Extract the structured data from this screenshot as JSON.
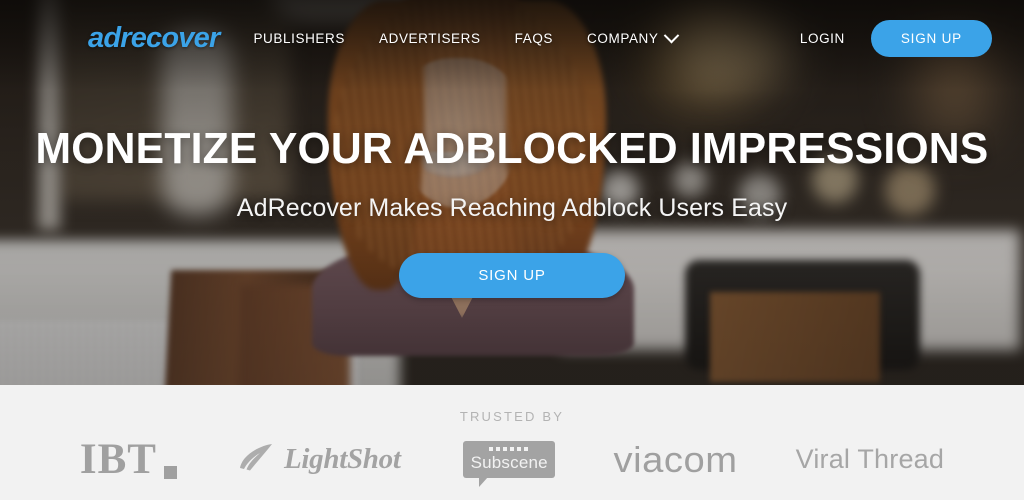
{
  "brand": {
    "logo_text": "adrecover",
    "accent_color": "#3ba3e8"
  },
  "nav": {
    "links": [
      {
        "label": "PUBLISHERS",
        "has_caret": false
      },
      {
        "label": "ADVERTISERS",
        "has_caret": false
      },
      {
        "label": "FAQS",
        "has_caret": false
      },
      {
        "label": "COMPANY",
        "has_caret": true
      }
    ],
    "login_label": "LOGIN",
    "signup_label": "SIGN UP"
  },
  "hero": {
    "headline": "MONETIZE YOUR ADBLOCKED IMPRESSIONS",
    "subheadline": "AdRecover Makes Reaching Adblock Users Easy",
    "cta_label": "SIGN UP"
  },
  "trusted": {
    "title": "TRUSTED BY",
    "logos": [
      {
        "name": "ibt",
        "text": "IBT"
      },
      {
        "name": "lightshot",
        "text": "LightShot"
      },
      {
        "name": "subscene",
        "text": "Subscene"
      },
      {
        "name": "viacom",
        "text": "viacom"
      },
      {
        "name": "viral-thread",
        "text": "Viral Thread"
      }
    ]
  }
}
